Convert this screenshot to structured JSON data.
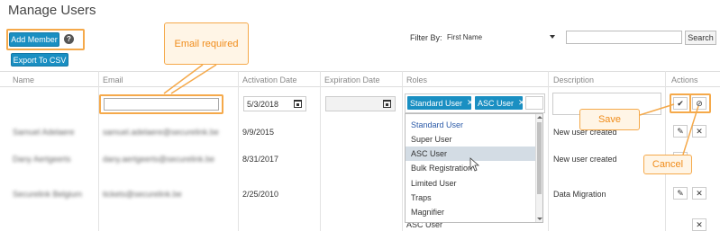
{
  "page": {
    "title": "Manage Users"
  },
  "toolbar": {
    "add_member_label": "Add Member",
    "help_label": "?",
    "export_label": "Export To CSV",
    "filter_label": "Filter By:",
    "filter_value": "First Name",
    "search_value": "",
    "search_label": "Search"
  },
  "table": {
    "headers": [
      "Name",
      "Email",
      "Activation Date",
      "Expiration Date",
      "Roles",
      "Description",
      "Actions"
    ],
    "new_row": {
      "email_value": "",
      "activation_date": "5/3/2018",
      "expiration_date": "",
      "roles": [
        "Standard User",
        "ASC User"
      ],
      "description": ""
    },
    "rows": [
      {
        "name": "Samuel Adelaere",
        "email": "samuel.adelaere@securelink.be",
        "activation_date": "9/9/2015",
        "description": "New user created"
      },
      {
        "name": "Dany Aertgeerts",
        "email": "dany.aertgeerts@securelink.be",
        "activation_date": "8/31/2017",
        "description": "New user created"
      },
      {
        "name": "Securelink Belgium",
        "email": "tickets@securelink.be",
        "activation_date": "2/25/2010",
        "description": "Data Migration",
        "roles_partial": "ASC User"
      }
    ]
  },
  "role_dropdown": {
    "options": [
      "Standard User",
      "Super User",
      "ASC User",
      "Bulk Registration",
      "Limited User",
      "Traps",
      "Magnifier"
    ],
    "hovered": "ASC User"
  },
  "annotations": {
    "email_required": "Email required",
    "save": "Save",
    "cancel": "Cancel"
  },
  "icons": {
    "help": "question-circle-icon",
    "calendar": "calendar-icon",
    "remove_tag": "x-icon",
    "save": "check-icon",
    "cancel": "ban-icon",
    "edit": "pencil-icon",
    "delete": "x-icon"
  },
  "colors": {
    "primary": "#1a8fc2",
    "callout": "#f5a94a",
    "callout_text": "#f08c1a",
    "hover": "#d3dce4"
  }
}
